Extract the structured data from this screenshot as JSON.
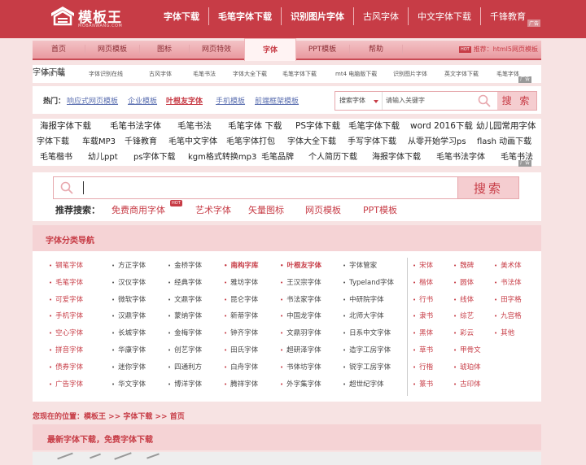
{
  "header": {
    "logo_title": "模板王",
    "logo_sub": "MOBANWANG.COM",
    "nav": [
      "字体下载",
      "毛笔字体下载",
      "识别图片字体",
      "古风字体",
      "中文字体下载",
      "千锋教育"
    ],
    "ad_mark": "广告"
  },
  "main_nav": {
    "tabs": [
      "首页",
      "网页模板",
      "图标",
      "网页特效",
      "字体",
      "PPT模板",
      "帮助"
    ],
    "active_tab": "字体",
    "hot_badge": "HOT",
    "promo": "推荐：html5网页模板"
  },
  "subnav": {
    "items": [
      "字体下载",
      "字体识别在线",
      "古风字体",
      "毛笔书法",
      "字体大全下载",
      "毛笔字体下载",
      "mt4 电脑版下载",
      "识别图片字体",
      "英文字体下载",
      "毛笔字体"
    ],
    "ad_tag": "广告"
  },
  "hot_search": {
    "label": "热门：",
    "links": [
      "响应式网页模板",
      "企业模板",
      "叶根友字体",
      "手机模板",
      "前端框架模板"
    ],
    "select_value": "搜索字体",
    "input_placeholder": "请输入关键字",
    "button": "搜 索"
  },
  "keywords": {
    "row1": [
      "海报字体下载",
      "毛笔书法字体",
      "毛笔书法",
      "毛笔字体 下载",
      "PS字体下载",
      "毛笔字体下载",
      "word 2016下载",
      "幼儿园常用字体"
    ],
    "row2": [
      "字体下载",
      "车载MP3",
      "千锋教育",
      "毛笔中文字体",
      "毛笔字体打包",
      "字体大全下载",
      "手写字体下载",
      "从零开始学习ps",
      "flash 动画下载"
    ],
    "row3": [
      "毛笔楷书",
      "幼儿ppt",
      "ps字体下载",
      "kgm格式转换mp3",
      "毛笔品牌",
      "个人简历下载",
      "海报字体下载",
      "毛笔书法字体",
      "毛笔书法"
    ],
    "ad_tag": "广告"
  },
  "big_search": {
    "button": "搜索",
    "rec_label": "推荐搜索：",
    "rec_items": [
      "免费商用字体",
      "艺术字体",
      "矢量图标",
      "网页模板",
      "PPT模板"
    ],
    "hot_badge": "HOT"
  },
  "category": {
    "title": "字体分类导航",
    "col1": [
      "钢笔字体",
      "毛笔字体",
      "可爱字体",
      "手机字体",
      "空心字体",
      "拼音字体",
      "债券字体",
      "广告字体"
    ],
    "col2": [
      "方正字体",
      "汉仪字体",
      "微软字体",
      "汉鼎字体",
      "长城字体",
      "华康字体",
      "迷你字体",
      "华文字体"
    ],
    "col3": [
      "金桥字体",
      "经典字体",
      "文鼎字体",
      "蒙纳字体",
      "金梅字体",
      "创艺字体",
      "四通利方",
      "博洋字体"
    ],
    "col4": [
      "南构字库",
      "雅坊字体",
      "昆仑字体",
      "新蒂字体",
      "钟齐字体",
      "田氏字体",
      "白舟字体",
      "腾祥字体"
    ],
    "col5": [
      "叶根友字体",
      "王汉宗字体",
      "书法家字体",
      "中国龙字体",
      "文鼎羽字体",
      "超研泽字体",
      "书体坊字体",
      "外字集字体"
    ],
    "col6": [
      "字体管家",
      "Typeland字体",
      "中研院字体",
      "北师大字体",
      "日系中文字体",
      "造字工房字体",
      "锐字工房字体",
      "超世纪字体"
    ],
    "col7": [
      "宋体",
      "楷体",
      "行书",
      "隶书",
      "黑体",
      "草书",
      "行楷",
      "篆书"
    ],
    "col8": [
      "魏碑",
      "圆体",
      "线体",
      "综艺",
      "彩云",
      "甲骨文",
      "琥珀体",
      "古印体"
    ],
    "col9": [
      "美术体",
      "书法体",
      "田字格",
      "九宫格",
      "其他"
    ]
  },
  "breadcrumb": {
    "prefix": "您现在的位置：",
    "path": "模板王 >> 字体下载 >> 首页"
  },
  "latest": {
    "title": "最新字体下载，免费字体下载"
  }
}
